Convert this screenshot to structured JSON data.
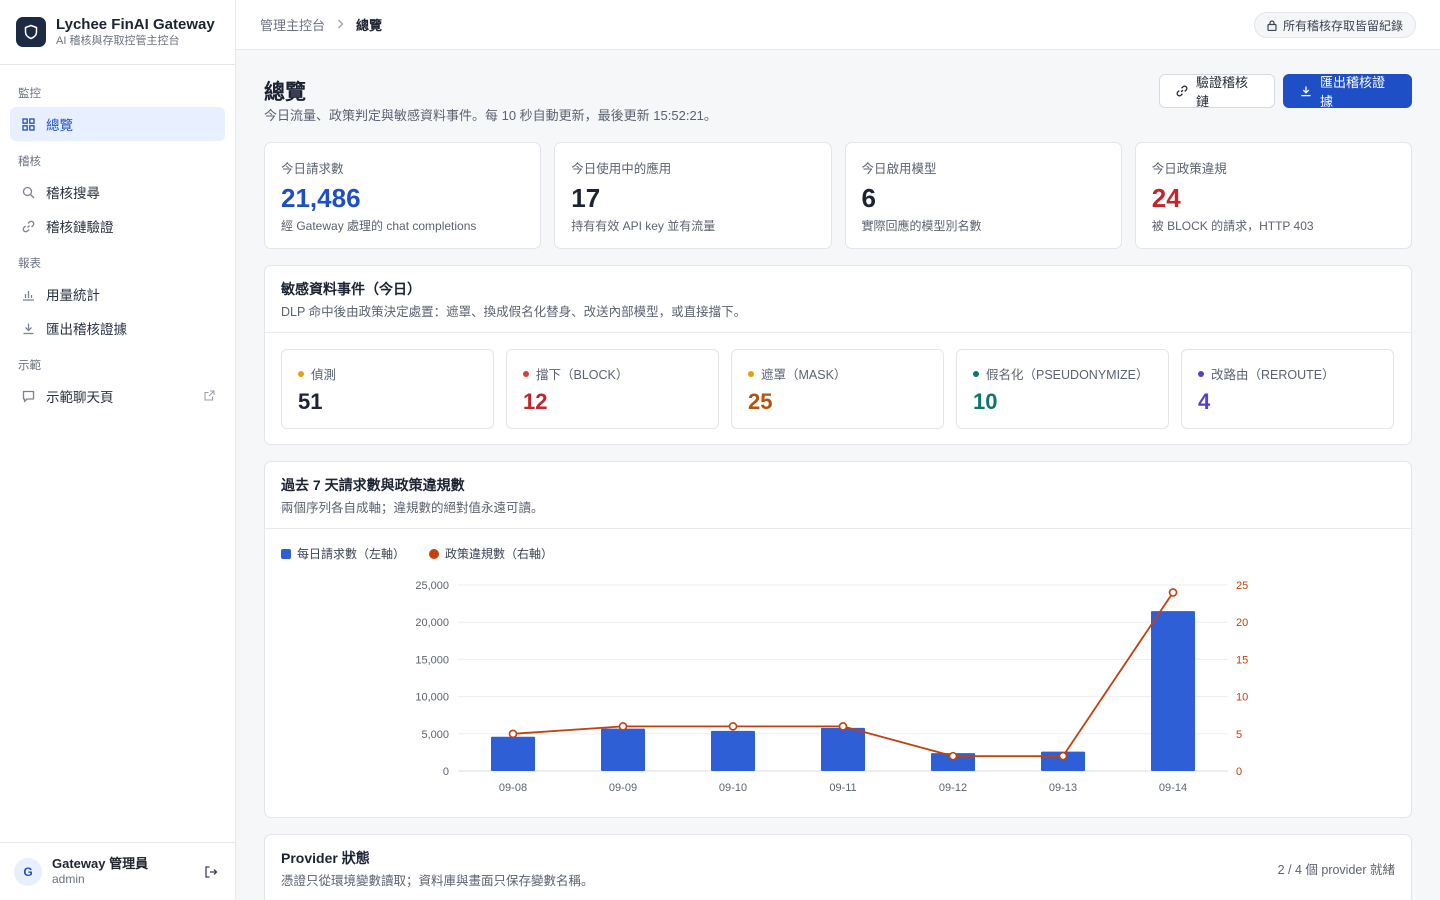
{
  "brand": {
    "name": "Lychee FinAI Gateway",
    "subtitle": "AI 稽核與存取控管主控台"
  },
  "sidebar": {
    "groups": [
      {
        "label": "監控",
        "items": [
          {
            "label": "總覽",
            "icon": "grid-icon",
            "active": true
          }
        ]
      },
      {
        "label": "稽核",
        "items": [
          {
            "label": "稽核搜尋",
            "icon": "search-icon"
          },
          {
            "label": "稽核鏈驗證",
            "icon": "link-icon"
          }
        ]
      },
      {
        "label": "報表",
        "items": [
          {
            "label": "用量統計",
            "icon": "bar-chart-icon"
          },
          {
            "label": "匯出稽核證據",
            "icon": "download-icon"
          }
        ]
      },
      {
        "label": "示範",
        "items": [
          {
            "label": "示範聊天頁",
            "icon": "chat-icon",
            "external": true
          }
        ]
      }
    ]
  },
  "user": {
    "initial": "G",
    "name": "Gateway 管理員",
    "role": "admin"
  },
  "topbar": {
    "breadcrumb_root": "管理主控台",
    "breadcrumb_current": "總覽",
    "retention_notice": "所有稽核存取皆留紀錄"
  },
  "page": {
    "title": "總覽",
    "subtitle": "今日流量、政策判定與敏感資料事件。每 10 秒自動更新，最後更新 15:52:21。",
    "verify_button": "驗證稽核鏈",
    "export_button": "匯出稽核證據"
  },
  "stats": [
    {
      "label": "今日請求數",
      "value": "21,486",
      "desc": "經 Gateway 處理的 chat completions",
      "color": "#1e4fc6"
    },
    {
      "label": "今日使用中的應用",
      "value": "17",
      "desc": "持有有效 API key 並有流量",
      "color": "#1c2333"
    },
    {
      "label": "今日啟用模型",
      "value": "6",
      "desc": "實際回應的模型別名數",
      "color": "#1c2333"
    },
    {
      "label": "今日政策違規",
      "value": "24",
      "desc": "被 BLOCK 的請求，HTTP 403",
      "color": "#c0262d"
    }
  ],
  "dlp": {
    "title": "敏感資料事件（今日）",
    "subtitle": "DLP 命中後由政策決定處置：遮罩、換成假名化替身、改送內部模型，或直接擋下。",
    "items": [
      {
        "label": "偵測",
        "value": "51",
        "dot": "#e5a00d",
        "color": "#1c2333"
      },
      {
        "label": "擋下（BLOCK）",
        "value": "12",
        "dot": "#dc3b3b",
        "color": "#c0262d"
      },
      {
        "label": "遮罩（MASK）",
        "value": "25",
        "dot": "#e5a00d",
        "color": "#b45309"
      },
      {
        "label": "假名化（PSEUDONYMIZE）",
        "value": "10",
        "dot": "#0f766e",
        "color": "#0f766e"
      },
      {
        "label": "改路由（REROUTE）",
        "value": "4",
        "dot": "#5b3fc4",
        "color": "#5b3fc4"
      }
    ]
  },
  "trend": {
    "title": "過去 7 天請求數與政策違規數",
    "subtitle": "兩個序列各自成軸；違規數的絕對值永遠可讀。"
  },
  "chart_data": {
    "type": "bar",
    "categories": [
      "09-08",
      "09-09",
      "09-10",
      "09-11",
      "09-12",
      "09-13",
      "09-14"
    ],
    "series": [
      {
        "name": "每日請求數（左軸）",
        "type": "bar",
        "axis": "left",
        "color": "#2f5fd6",
        "values": [
          4600,
          5700,
          5400,
          5800,
          2400,
          2600,
          21486
        ]
      },
      {
        "name": "政策違規數（右軸）",
        "type": "line",
        "axis": "right",
        "color": "#c2410c",
        "values": [
          5,
          6,
          6,
          6,
          2,
          2,
          24
        ]
      }
    ],
    "y_left": {
      "lim": [
        0,
        25000
      ],
      "ticks": [
        "0",
        "5,000",
        "10,000",
        "15,000",
        "20,000",
        "25,000"
      ]
    },
    "y_right": {
      "lim": [
        0,
        25
      ],
      "ticks": [
        "0",
        "5",
        "10",
        "15",
        "20",
        "25"
      ]
    },
    "grid": true,
    "legend": "top-left"
  },
  "provider": {
    "title": "Provider 狀態",
    "subtitle": "憑證只從環境變數讀取；資料庫與畫面只保存變數名稱。",
    "status": "2 / 4 個 provider 就緒"
  }
}
